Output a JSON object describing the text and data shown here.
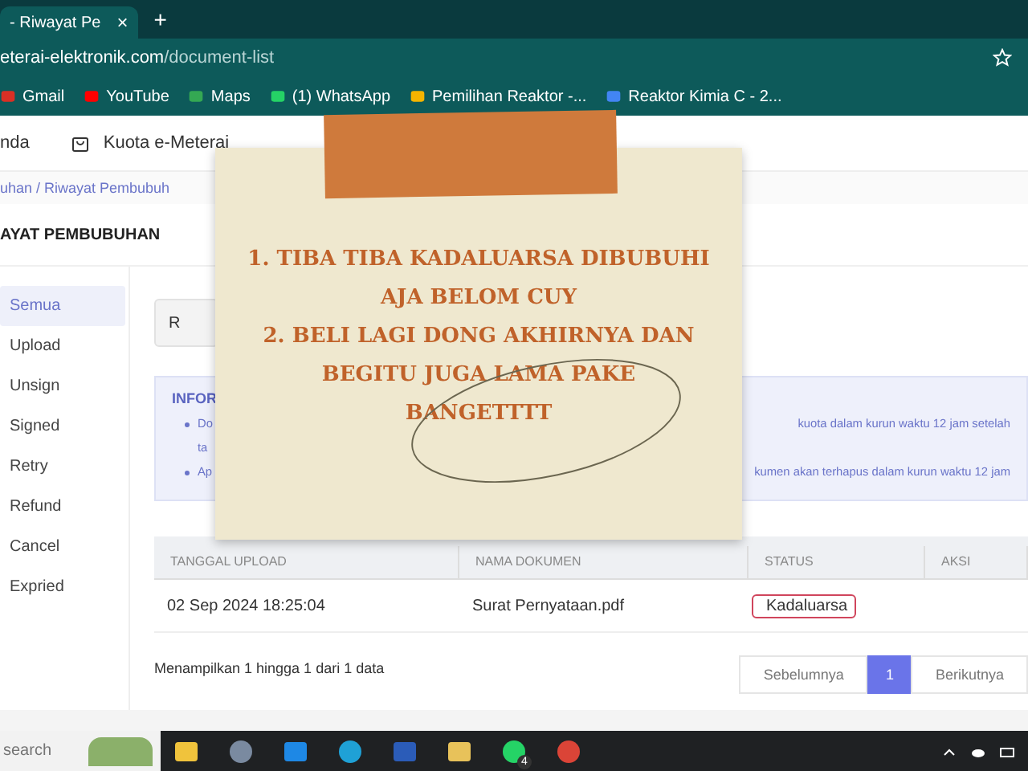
{
  "browser": {
    "tab_title": "- Riwayat Pe",
    "tab_close": "×",
    "new_tab": "+",
    "url_host": "eterai-elektronik.com",
    "url_path": "/document-list",
    "bookmarks": [
      {
        "label": "Gmail",
        "kind": "mail"
      },
      {
        "label": "YouTube",
        "kind": "video"
      },
      {
        "label": "Maps",
        "kind": "map"
      },
      {
        "label": "(1) WhatsApp",
        "kind": "chat"
      },
      {
        "label": "Pemilihan Reaktor -...",
        "kind": "slides"
      },
      {
        "label": "Reaktor Kimia C - 2...",
        "kind": "doc"
      }
    ]
  },
  "nav": [
    {
      "label": "nda",
      "kind": "plain"
    },
    {
      "label": "Kuota e-Meterai",
      "kind": "bag"
    }
  ],
  "breadcrumb": "uhan / Riwayat Pembubuh",
  "page_title": "AYAT PEMBUBUHAN",
  "sidebar": [
    {
      "label": "Semua",
      "selected": true
    },
    {
      "label": "Upload",
      "selected": false
    },
    {
      "label": "Unsign",
      "selected": false
    },
    {
      "label": "Signed",
      "selected": false
    },
    {
      "label": "Retry",
      "selected": false
    },
    {
      "label": "Refund",
      "selected": false
    },
    {
      "label": "Cancel",
      "selected": false
    },
    {
      "label": "Expried",
      "selected": false
    }
  ],
  "filter_field": {
    "value": "R"
  },
  "info": {
    "title": "INFOR",
    "lines": [
      {
        "left": "Do",
        "right": "kuota dalam kurun waktu 12 jam setelah",
        "bullet": true
      },
      {
        "left": "ta",
        "bullet": false
      },
      {
        "left": "Ap",
        "right": "kumen akan terhapus dalam kurun waktu 12 jam",
        "bullet": true
      }
    ]
  },
  "table": {
    "columns": [
      "TANGGAL UPLOAD",
      "NAMA DOKUMEN",
      "STATUS",
      "AKSI"
    ],
    "rows": [
      {
        "date": "02 Sep 2024 18:25:04",
        "name": "Surat Pernyataan.pdf",
        "status": "Kadaluarsa"
      }
    ]
  },
  "summary": "Menampilkan 1 hingga 1 dari 1 data",
  "pagination": [
    {
      "label": "Sebelumnya",
      "selected": false
    },
    {
      "label": "1",
      "selected": true
    },
    {
      "label": "Berikutnya",
      "selected": false
    }
  ],
  "note": {
    "lines": [
      "1. TIBA TIBA KADALUARSA DIBUBUHI",
      "AJA BELOM CUY",
      "2. BELI LAGI DONG AKHIRNYA DAN",
      "BEGITU JUGA LAMA PAKE",
      "BANGETTTT"
    ]
  },
  "taskbar": {
    "placeholder": "search",
    "apps": [
      {
        "kind": "store"
      },
      {
        "kind": "globe"
      },
      {
        "kind": "mail"
      },
      {
        "kind": "edge"
      },
      {
        "kind": "v"
      },
      {
        "kind": "folder"
      },
      {
        "kind": "chat",
        "badge": "4"
      },
      {
        "kind": "chrome"
      }
    ]
  }
}
